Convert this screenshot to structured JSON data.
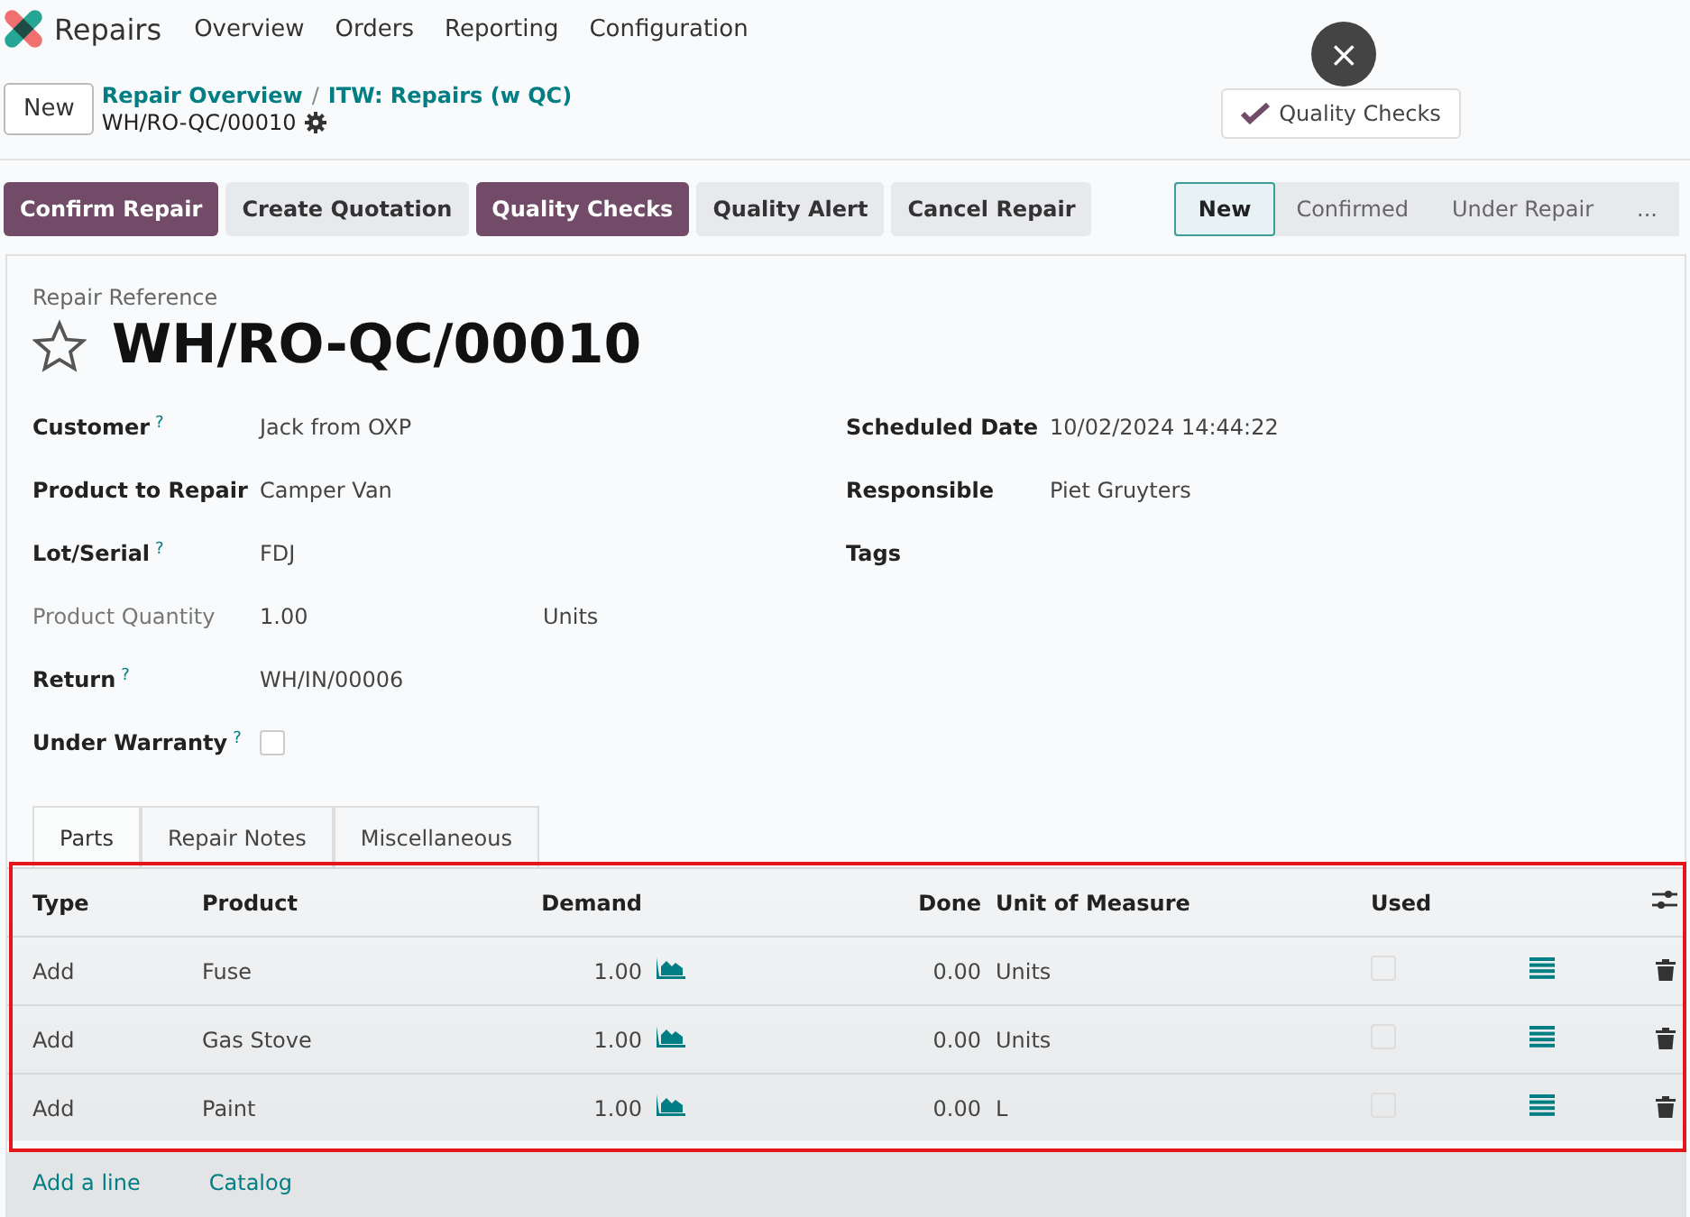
{
  "nav": {
    "app": "Repairs",
    "menu": [
      "Overview",
      "Orders",
      "Reporting",
      "Configuration"
    ]
  },
  "control": {
    "new_button": "New",
    "breadcrumbs": [
      "Repair Overview",
      "ITW: Repairs (w QC)"
    ],
    "breadcrumb_separator": "/",
    "record": "WH/RO-QC/00010",
    "quality_button": "Quality Checks",
    "close_glyph": "×"
  },
  "actions": [
    {
      "label": "Confirm Repair",
      "kind": "primary"
    },
    {
      "label": "Create Quotation",
      "kind": "secondary"
    },
    {
      "label": "Quality Checks",
      "kind": "primary"
    },
    {
      "label": "Quality Alert",
      "kind": "secondary"
    },
    {
      "label": "Cancel Repair",
      "kind": "secondary"
    }
  ],
  "stages": [
    {
      "label": "New",
      "selected": true
    },
    {
      "label": "Confirmed",
      "selected": false
    },
    {
      "label": "Under Repair",
      "selected": false
    },
    {
      "label": "...",
      "selected": false
    }
  ],
  "sheet": {
    "reference_label": "Repair Reference",
    "title": "WH/RO-QC/00010",
    "starred": false,
    "left_fields": [
      {
        "label": "Customer",
        "help": "?",
        "muted": false,
        "kind": "text",
        "value": "Jack from OXP"
      },
      {
        "label": "Product to Repair",
        "muted": false,
        "kind": "text",
        "value": "Camper Van"
      },
      {
        "label": "Lot/Serial",
        "help": "?",
        "muted": false,
        "kind": "text",
        "value": "FDJ"
      },
      {
        "label": "Product Quantity",
        "muted": true,
        "kind": "quantity",
        "value": "1.00",
        "unit": "Units"
      },
      {
        "label": "Return",
        "help": "?",
        "muted": false,
        "kind": "text",
        "value": "WH/IN/00006"
      },
      {
        "label": "Under Warranty",
        "help": "?",
        "muted": false,
        "kind": "checkbox",
        "checked": false
      }
    ],
    "right_fields": [
      {
        "label": "Scheduled Date",
        "value": "10/02/2024 14:44:22"
      },
      {
        "label": "Responsible",
        "value": "Piet Gruyters"
      },
      {
        "label": "Tags"
      }
    ],
    "tabs": [
      {
        "label": "Parts",
        "selected": true
      },
      {
        "label": "Repair Notes",
        "selected": false
      },
      {
        "label": "Miscellaneous",
        "selected": false
      }
    ],
    "table": {
      "columns": [
        "Type",
        "Product",
        "Demand",
        "Done",
        "Unit of Measure",
        "Used"
      ],
      "rows": [
        {
          "type": "Add",
          "product": "Fuse",
          "demand": "1.00",
          "done": "0.00",
          "uom": "Units",
          "used": false
        },
        {
          "type": "Add",
          "product": "Gas Stove",
          "demand": "1.00",
          "done": "0.00",
          "uom": "Units",
          "used": false
        },
        {
          "type": "Add",
          "product": "Paint",
          "demand": "1.00",
          "done": "0.00",
          "uom": "L",
          "used": false
        }
      ],
      "links": [
        "Add a line",
        "Catalog"
      ]
    }
  }
}
